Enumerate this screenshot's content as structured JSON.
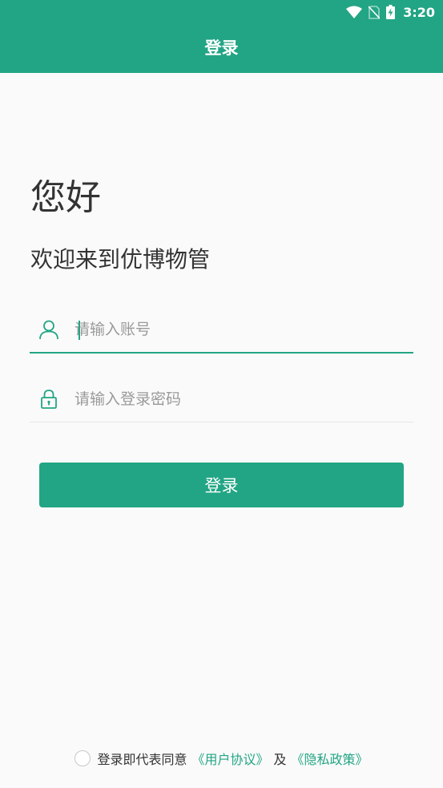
{
  "status_bar": {
    "time": "3:20"
  },
  "header": {
    "title": "登录"
  },
  "greeting": {
    "hello": "您好",
    "welcome": "欢迎来到优博物管"
  },
  "form": {
    "account_placeholder": "请输入账号",
    "password_placeholder": "请输入登录密码",
    "login_label": "登录"
  },
  "agreement": {
    "prefix": "登录即代表同意",
    "user_agreement": "《用户协议》",
    "and": "及",
    "privacy_policy": "《隐私政策》"
  },
  "colors": {
    "brand": "#22a584",
    "background": "#fafafa",
    "text": "#333333"
  },
  "icons": [
    "wifi-icon",
    "no-sim-icon",
    "battery-charging-icon",
    "user-icon",
    "lock-icon"
  ]
}
